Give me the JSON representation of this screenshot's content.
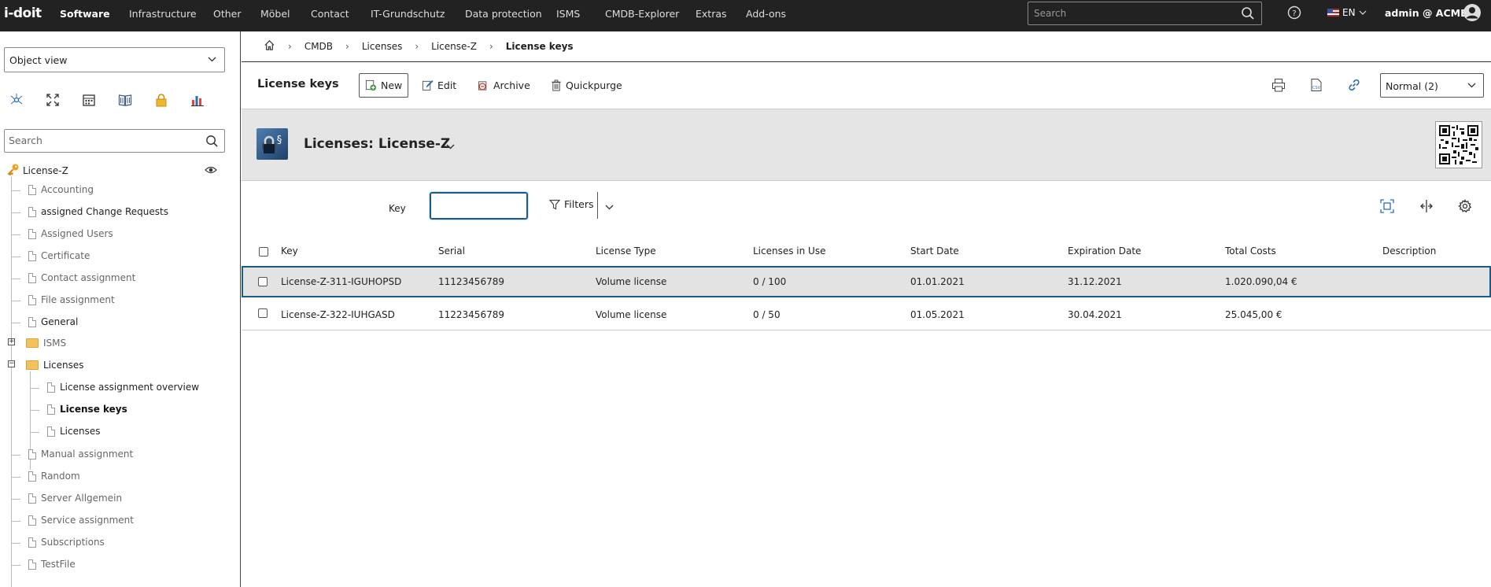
{
  "topbar": {
    "logo": "i-doit",
    "nav": [
      {
        "label": "Software",
        "active": true
      },
      {
        "label": "Infrastructure"
      },
      {
        "label": "Other"
      },
      {
        "label": "Möbel"
      },
      {
        "label": "Contact"
      },
      {
        "label": "IT-Grundschutz"
      },
      {
        "label": "Data protection"
      },
      {
        "label": "ISMS"
      },
      {
        "label": "CMDB-Explorer"
      },
      {
        "label": "Extras"
      },
      {
        "label": "Add-ons"
      }
    ],
    "search_placeholder": "Search",
    "language": "EN",
    "user": "admin @ ACME"
  },
  "sidebar": {
    "view_select": "Object view",
    "search_placeholder": "Search",
    "root": "License-Z",
    "items": [
      {
        "label": "Accounting"
      },
      {
        "label": "assigned Change Requests"
      },
      {
        "label": "Assigned Users"
      },
      {
        "label": "Certificate"
      },
      {
        "label": "Contact assignment"
      },
      {
        "label": "File assignment"
      },
      {
        "label": "General"
      },
      {
        "label": "ISMS"
      },
      {
        "label": "Licenses"
      },
      {
        "label": "License assignment overview"
      },
      {
        "label": "License keys"
      },
      {
        "label": "Licenses"
      },
      {
        "label": "Manual assignment"
      },
      {
        "label": "Random"
      },
      {
        "label": "Server Allgemein"
      },
      {
        "label": "Service assignment"
      },
      {
        "label": "Subscriptions"
      },
      {
        "label": "TestFile"
      }
    ]
  },
  "breadcrumb": [
    "CMDB",
    "Licenses",
    "License-Z",
    "License keys"
  ],
  "toolbar": {
    "title": "License keys",
    "new": "New",
    "edit": "Edit",
    "archive": "Archive",
    "quickpurge": "Quickpurge",
    "view_select": "Normal (2)"
  },
  "object": {
    "title": "Licenses: License-Z"
  },
  "filter": {
    "label": "Key",
    "value": "",
    "filters_label": "Filters"
  },
  "table": {
    "columns": [
      "Key",
      "Serial",
      "License Type",
      "Licenses in Use",
      "Start Date",
      "Expiration Date",
      "Total Costs",
      "Description"
    ],
    "rows": [
      [
        "License-Z-311-IGUHOPSD",
        "11123456789",
        "Volume license",
        "0 / 100",
        "01.01.2021",
        "31.12.2021",
        "1.020.090,04 €",
        ""
      ],
      [
        "License-Z-322-IUHGASD",
        "11223456789",
        "Volume license",
        "0 / 50",
        "01.05.2021",
        "30.04.2021",
        "25.045,00 €",
        ""
      ]
    ]
  }
}
